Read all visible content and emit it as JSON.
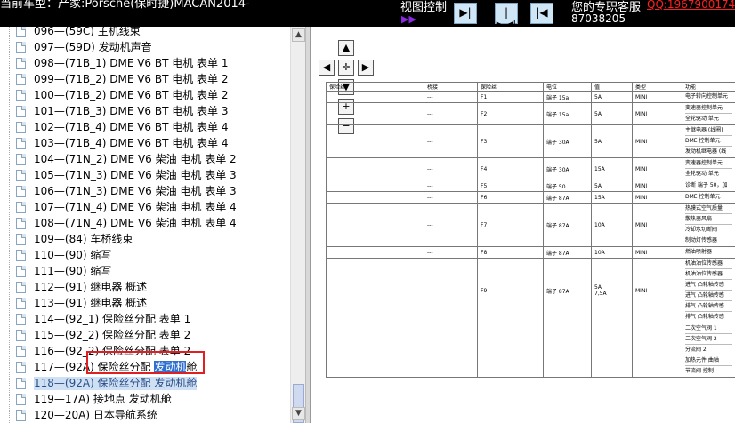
{
  "header": {
    "model_text": "当前车型：产家:Porsche(保时捷)MACAN2014-",
    "view_control_label": "视图控制",
    "view_mark": "▶▶",
    "view_buttons": [
      "▶|",
      "|▶◀|",
      "|◀"
    ],
    "service_label": "您的专职客服",
    "qq_text": "QQ:1967900174",
    "phone": "87038205"
  },
  "tree": {
    "items": [
      {
        "label": "096—(59C) 主机线束"
      },
      {
        "label": "097—(59D) 发动机声音"
      },
      {
        "label": "098—(71B_1) DME V6 BT 电机 表单 1"
      },
      {
        "label": "099—(71B_2) DME V6 BT 电机 表单 2"
      },
      {
        "label": "100—(71B_2) DME V6 BT 电机 表单 2"
      },
      {
        "label": "101—(71B_3) DME V6 BT 电机 表单 3"
      },
      {
        "label": "102—(71B_4) DME V6 BT 电机 表单 4"
      },
      {
        "label": "103—(71B_4) DME V6 BT 电机 表单 4"
      },
      {
        "label": "104—(71N_2) DME V6 柴油 电机 表单 2"
      },
      {
        "label": "105—(71N_3) DME V6 柴油 电机 表单 3"
      },
      {
        "label": "106—(71N_3) DME V6 柴油 电机 表单 3"
      },
      {
        "label": "107—(71N_4) DME V6 柴油 电机 表单 4"
      },
      {
        "label": "108—(71N_4) DME V6 柴油 电机 表单 4"
      },
      {
        "label": "109—(84) 车桥线束"
      },
      {
        "label": "110—(90) 缩写"
      },
      {
        "label": "111—(90) 缩写"
      },
      {
        "label": "112—(91) 继电器 概述"
      },
      {
        "label": "113—(91) 继电器 概述"
      },
      {
        "label": "114—(92_1) 保险丝分配 表单 1"
      },
      {
        "label": "115—(92_2) 保险丝分配 表单 2"
      },
      {
        "label": "116—(92_2) 保险丝分配 表单 2"
      },
      {
        "label": "117—(92A) 保险丝分配 ",
        "highlight": "发动机",
        "suffix": "舱"
      },
      {
        "label": "118—(92A) 保险丝分配 发动机舱",
        "active": true
      },
      {
        "label": "119—17A) 接地点 发动机舱"
      },
      {
        "label": "120—20A) 日本导航系统"
      },
      {
        "label": "121—(20A) 日本导航系统"
      }
    ],
    "scroll_up": "▲",
    "scroll_down": "▼"
  },
  "viewer": {
    "nav": {
      "up": "▲",
      "left": "◀",
      "center": "✛",
      "right": "▶",
      "down": "▼",
      "zoom_in": "+",
      "zoom_out": "−"
    },
    "table": {
      "headers": [
        "保险丝",
        "桥接",
        "保险丝",
        "电位",
        "值",
        "类型",
        "功能"
      ],
      "rows": [
        {
          "bridge": "---",
          "fuse": "F1",
          "pot": "端子 15a",
          "val": "5A",
          "type": "MINI",
          "funcs": [
            "电子转向控制单元"
          ]
        },
        {
          "bridge": "---",
          "fuse": "F2",
          "pot": "端子 15a",
          "val": "5A",
          "type": "MINI",
          "funcs": [
            "变速器控制单元",
            "全轮驱动 单元"
          ]
        },
        {
          "bridge": "---",
          "fuse": "F3",
          "pot": "端子 30A",
          "val": "5A",
          "type": "MINI",
          "funcs": [
            "主继电器 (线圈)",
            "DME 控制单元",
            "发动机继电器 (线"
          ]
        },
        {
          "bridge": "---",
          "fuse": "F4",
          "pot": "端子 30A",
          "val": "15A",
          "type": "MINI",
          "funcs": [
            "变速器控制单元",
            "全轮驱动 单元"
          ]
        },
        {
          "bridge": "---",
          "fuse": "F5",
          "pot": "端子 50",
          "val": "5A",
          "type": "MINI",
          "funcs": [
            "诊断 端子 50，加"
          ]
        },
        {
          "bridge": "---",
          "fuse": "F6",
          "pot": "端子 87A",
          "val": "15A",
          "type": "MINI",
          "funcs": [
            "DME 控制单元"
          ]
        },
        {
          "bridge": "---",
          "fuse": "F7",
          "pot": "端子 87A",
          "val": "10A",
          "type": "MINI",
          "funcs": [
            "热膜式空气质量",
            "散热器风扇",
            "冷却水切断阀",
            "制动灯传感器"
          ]
        },
        {
          "bridge": "---",
          "fuse": "F8",
          "pot": "端子 87A",
          "val": "10A",
          "type": "MINI",
          "funcs": [
            "燃油喷射器"
          ]
        },
        {
          "bridge": "---",
          "fuse": "F9",
          "pot": "端子 87A",
          "val": "5A\n7,5A",
          "type": "MINI",
          "funcs": [
            "机油油位传感器",
            "机油油位传感器",
            "进气 凸轮轴传感",
            "进气 凸轮轴传感",
            "排气 凸轮轴传感",
            "排气 凸轮轴传感"
          ]
        },
        {
          "bridge": "",
          "fuse": "",
          "pot": "",
          "val": "",
          "type": "",
          "funcs": [
            "二次空气阀 1",
            "二次空气阀 2",
            "分流阀 2",
            "加热元件 曲轴",
            "节流阀 控制"
          ]
        }
      ]
    }
  }
}
